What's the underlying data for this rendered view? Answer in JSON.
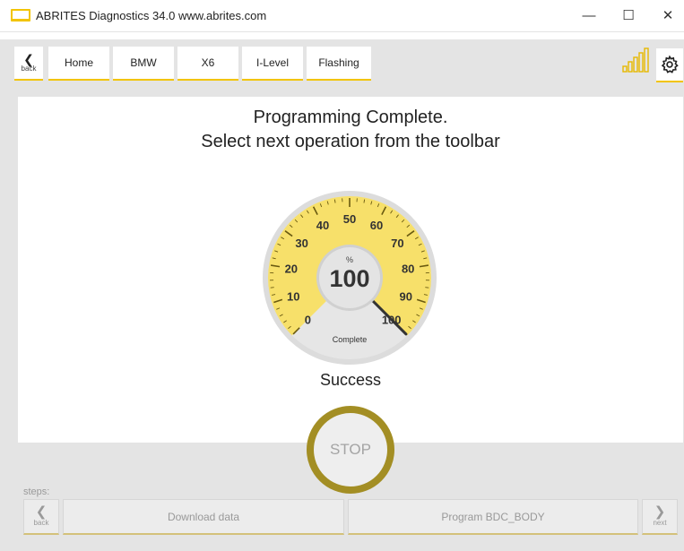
{
  "window": {
    "title": "ABRITES Diagnostics 34.0   www.abrites.com",
    "minimize_glyph": "—",
    "maximize_glyph": "☐",
    "close_glyph": "✕"
  },
  "toolbar": {
    "back_label": "back",
    "breadcrumbs": [
      "Home",
      "BMW",
      "X6",
      "I-Level",
      "Flashing"
    ],
    "signal_icon": "signal-bars-icon",
    "settings_icon": "gear-icon"
  },
  "main": {
    "heading_line1": "Programming Complete.",
    "heading_line2": "Select next operation from the toolbar",
    "gauge": {
      "unit": "%",
      "value": "100",
      "caption": "Complete",
      "scale_labels": [
        "0",
        "10",
        "20",
        "30",
        "40",
        "50",
        "60",
        "70",
        "80",
        "90",
        "100"
      ],
      "progress_fraction": 1.0
    },
    "status": "Success",
    "stop_label": "STOP"
  },
  "steps": {
    "label": "steps:",
    "back_label": "back",
    "next_label": "next",
    "items": [
      "Download data",
      "Program BDC_BODY"
    ]
  },
  "colors": {
    "accent": "#f2c400",
    "gauge_face": "#f7e06a",
    "gauge_rim": "#d9d9d9",
    "stop_ring": "#a38e24"
  }
}
